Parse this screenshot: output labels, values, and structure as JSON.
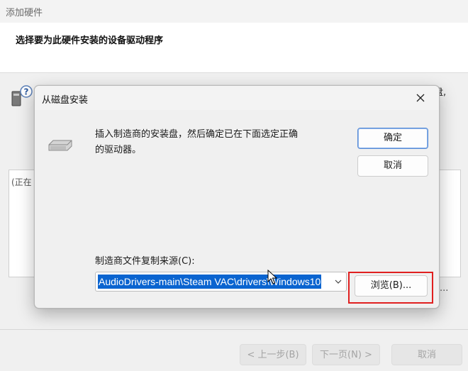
{
  "wizard": {
    "title": "添加硬件",
    "heading": "选择要为此硬件安装的设备驱动程序",
    "partial_text": "盘,",
    "listbox_text": "(正在",
    "hint_text": "...",
    "buttons": {
      "back": "< 上一步(B)",
      "next": "下一页(N) >",
      "cancel": "取消"
    }
  },
  "dialog": {
    "title": "从磁盘安装",
    "message": "插入制造商的安装盘，然后确定已在下面选定正确的驱动器。",
    "ok_label": "确定",
    "cancel_label": "取消",
    "source_label": "制造商文件复制来源(C):",
    "source_value": "AudioDrivers-main\\Steam VAC\\drivers\\Windows10",
    "browse_label": "浏览(B)..."
  },
  "colors": {
    "selection": "#0a64d0",
    "highlight_border": "#e02020",
    "default_button_border": "#5a8dd6"
  }
}
